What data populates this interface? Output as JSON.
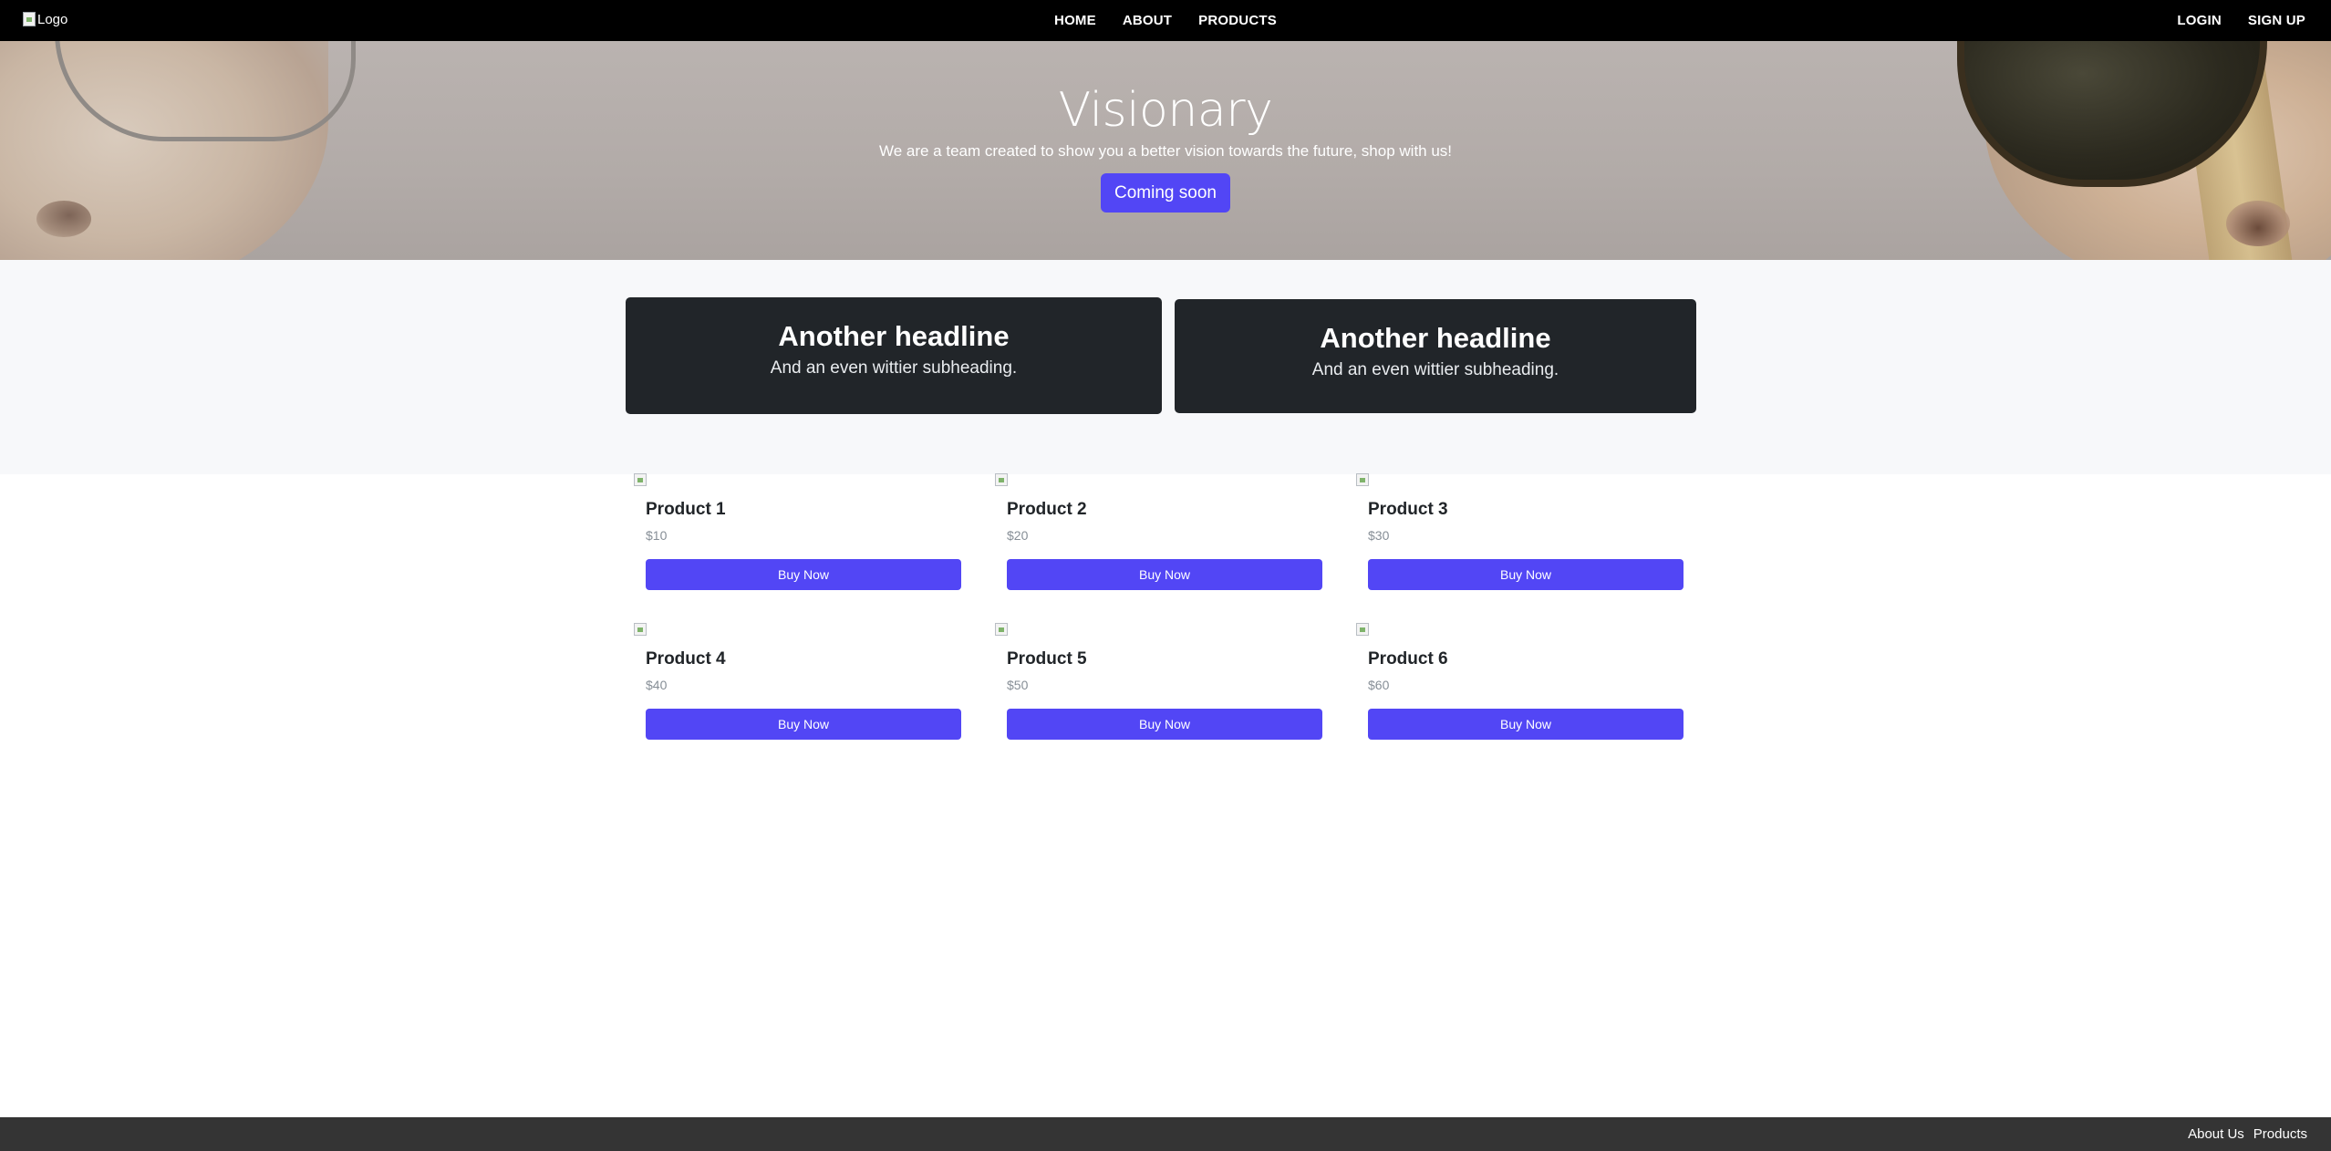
{
  "navbar": {
    "logo_alt": "Logo",
    "center_links": [
      "HOME",
      "ABOUT",
      "PRODUCTS"
    ],
    "right_links": [
      "LOGIN",
      "SIGN UP"
    ]
  },
  "hero": {
    "title": "Visionary",
    "subtitle": "We are a team created to show you a better vision towards the future, shop with us!",
    "button_label": "Coming soon"
  },
  "headlines": [
    {
      "title": "Another headline",
      "subtitle": "And an even wittier subheading."
    },
    {
      "title": "Another headline",
      "subtitle": "And an even wittier subheading."
    }
  ],
  "products": [
    {
      "name": "Product 1",
      "price": "$10",
      "button": "Buy Now"
    },
    {
      "name": "Product 2",
      "price": "$20",
      "button": "Buy Now"
    },
    {
      "name": "Product 3",
      "price": "$30",
      "button": "Buy Now"
    },
    {
      "name": "Product 4",
      "price": "$40",
      "button": "Buy Now"
    },
    {
      "name": "Product 5",
      "price": "$50",
      "button": "Buy Now"
    },
    {
      "name": "Product 6",
      "price": "$60",
      "button": "Buy Now"
    }
  ],
  "footer": {
    "links": [
      "About Us",
      "Products"
    ]
  },
  "colors": {
    "navbar_bg": "#000000",
    "accent": "#5246f5",
    "headline_card_bg": "#212529",
    "footer_bg": "#343434"
  }
}
